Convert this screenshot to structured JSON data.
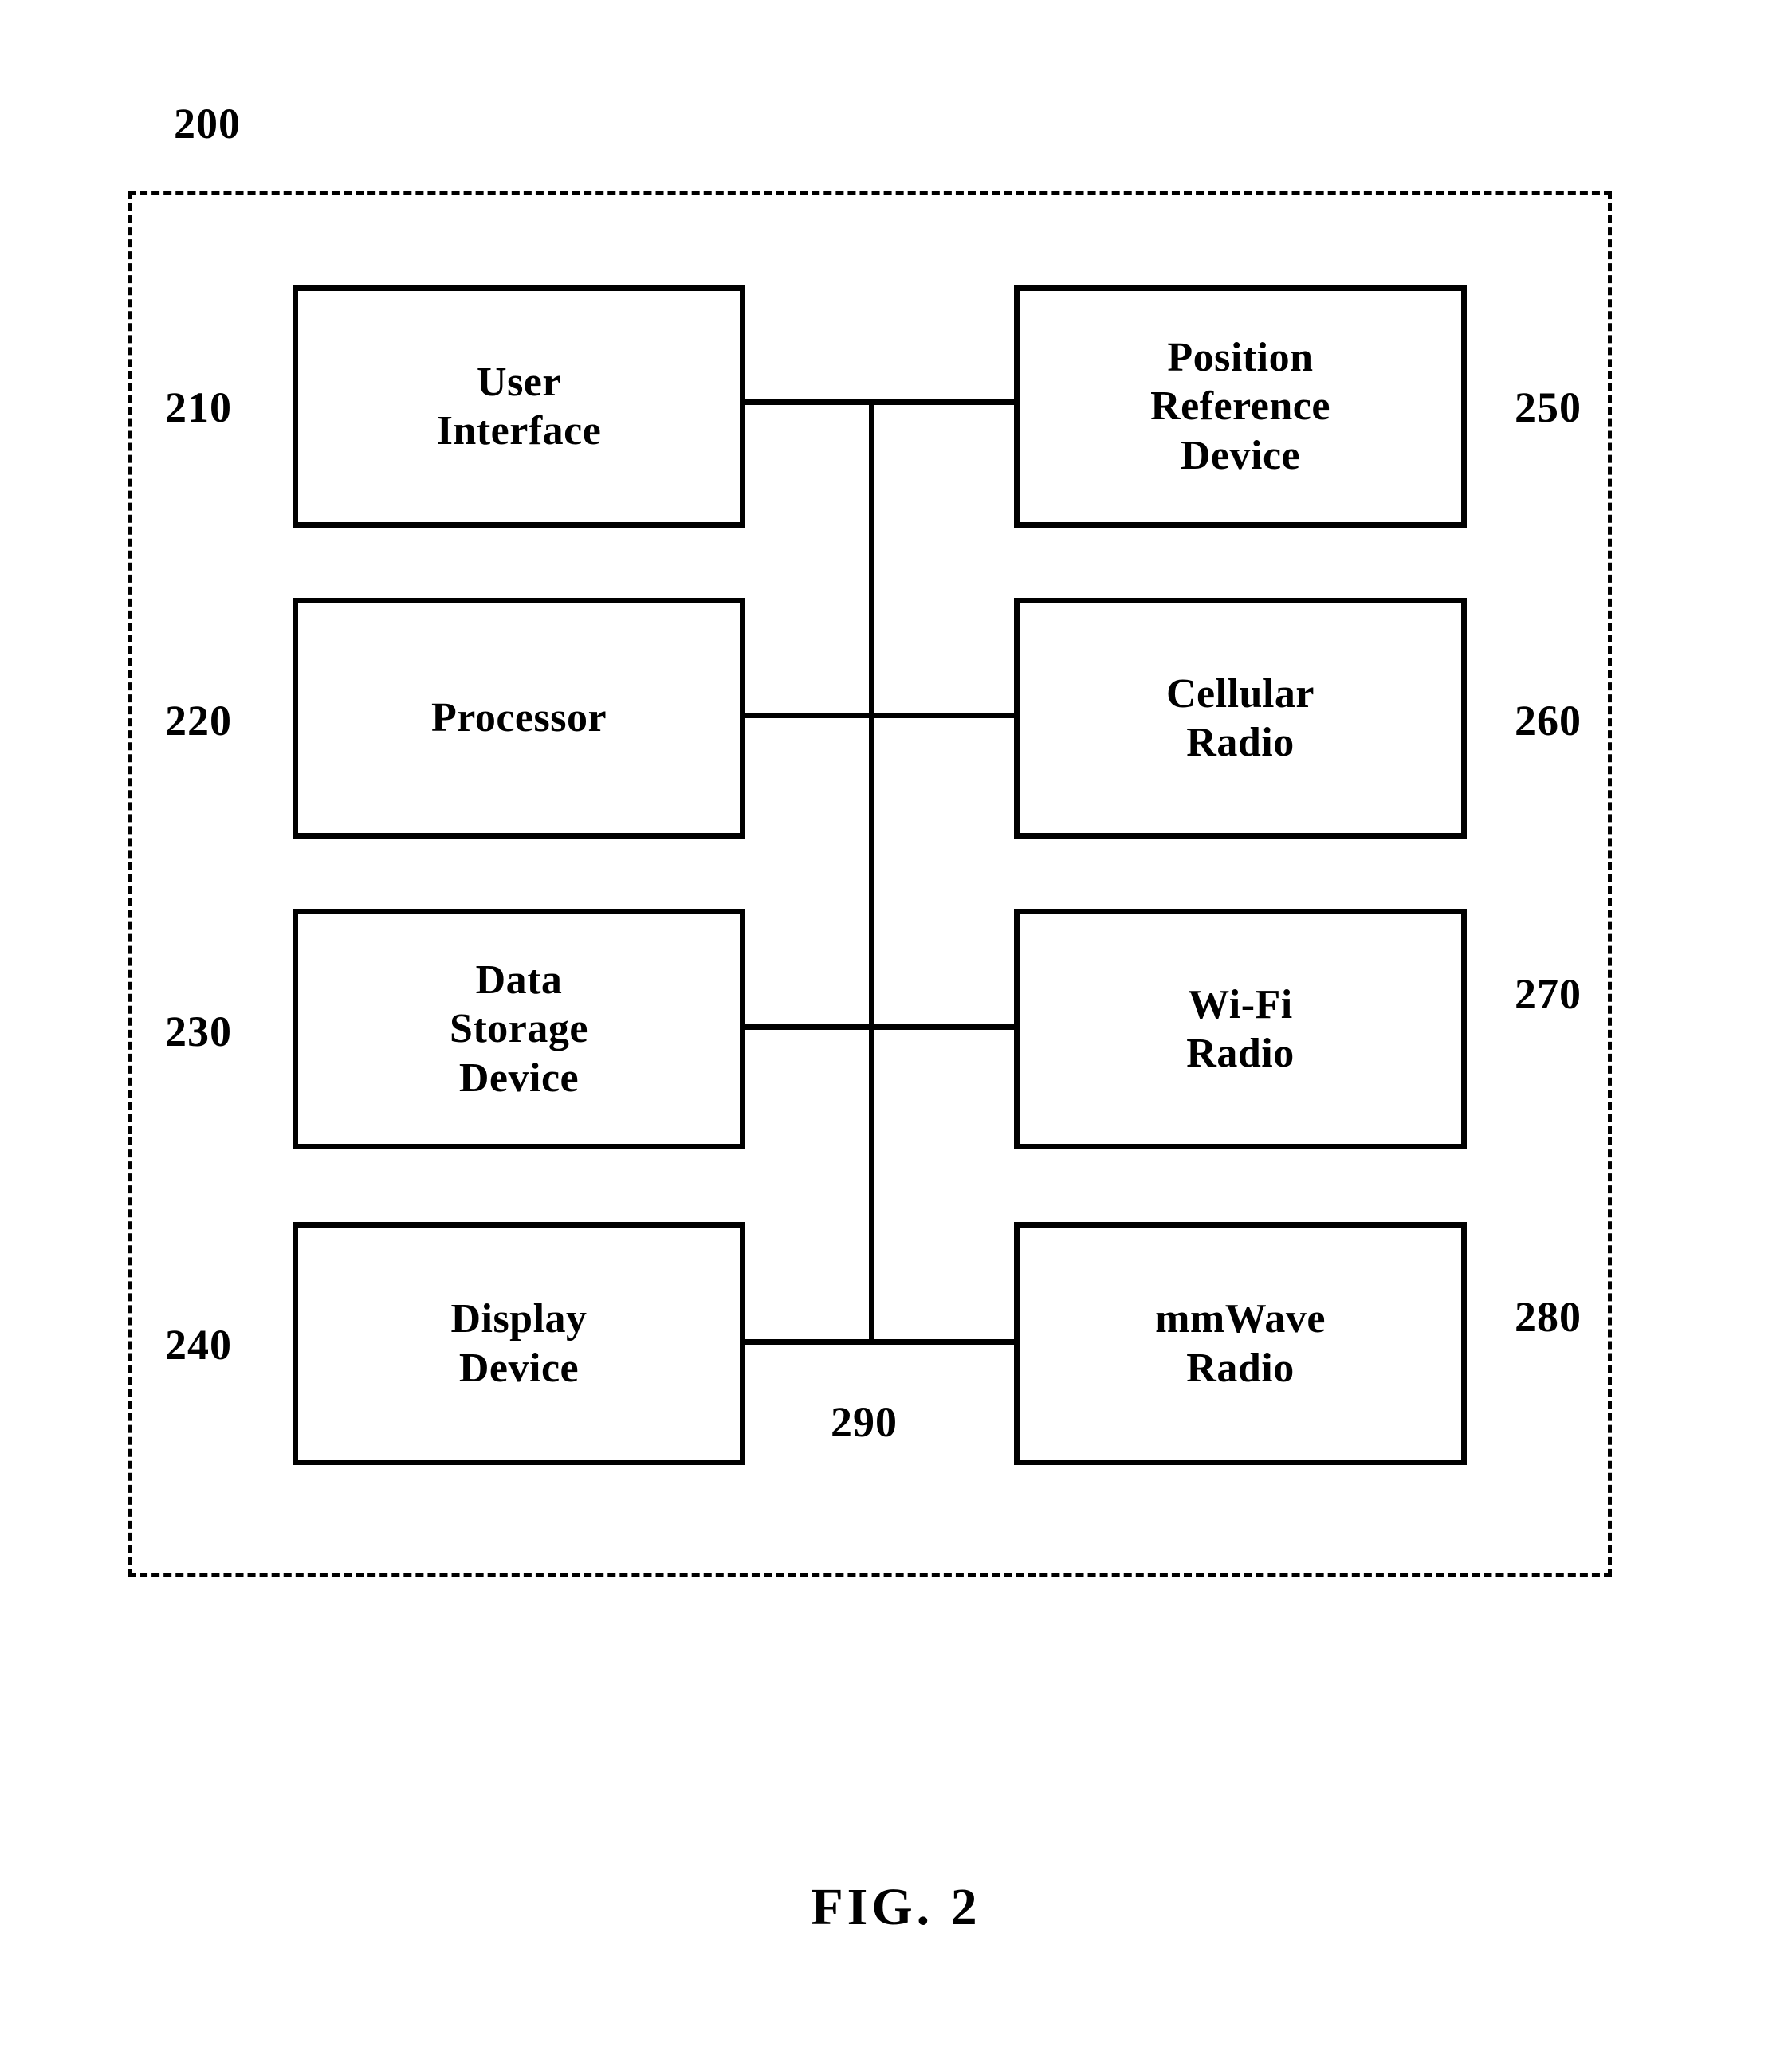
{
  "figure": {
    "caption": "FIG. 2",
    "system_numeral": "200"
  },
  "blocks": [
    {
      "id": "user-interface",
      "label": "User\nInterface",
      "numeral": "210",
      "column": "left"
    },
    {
      "id": "processor",
      "label": "Processor",
      "numeral": "220",
      "column": "left"
    },
    {
      "id": "data-storage",
      "label": "Data\nStorage\nDevice",
      "numeral": "230",
      "column": "left"
    },
    {
      "id": "display-device",
      "label": "Display\nDevice",
      "numeral": "240",
      "column": "left"
    },
    {
      "id": "position-reference",
      "label": "Position\nReference\nDevice",
      "numeral": "250",
      "column": "right"
    },
    {
      "id": "cellular-radio",
      "label": "Cellular\nRadio",
      "numeral": "260",
      "column": "right"
    },
    {
      "id": "wifi-radio",
      "label": "Wi-Fi\nRadio",
      "numeral": "270",
      "column": "right"
    },
    {
      "id": "mmwave-radio",
      "label": "mmWave\nRadio",
      "numeral": "280",
      "column": "right"
    }
  ],
  "bus": {
    "numeral": "290"
  },
  "colors": {
    "line": "#000000",
    "background": "#ffffff"
  }
}
